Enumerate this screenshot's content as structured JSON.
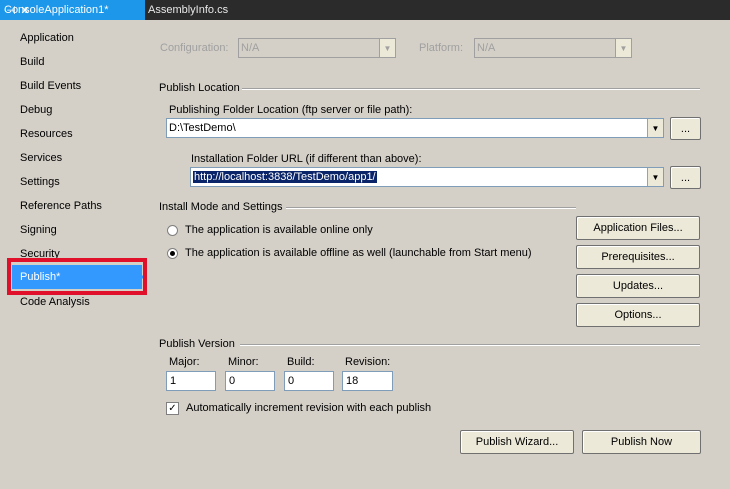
{
  "tabs": {
    "active_label": "ConsoleApplication1*",
    "pin_glyph": "⊣",
    "close_glyph": "✕",
    "inactive_label": "AssemblyInfo.cs"
  },
  "nav": {
    "items": [
      "Application",
      "Build",
      "Build Events",
      "Debug",
      "Resources",
      "Services",
      "Settings",
      "Reference Paths",
      "Signing",
      "Security"
    ],
    "selected": "Publish*",
    "after": "Code Analysis"
  },
  "config": {
    "configuration_label": "Configuration:",
    "configuration_value": "N/A",
    "platform_label": "Platform:",
    "platform_value": "N/A"
  },
  "publish_location": {
    "title": "Publish Location",
    "folder_label": "Publishing Folder Location (ftp server or file path):",
    "folder_value": "D:\\TestDemo\\",
    "browse": "...",
    "install_label": "Installation Folder URL (if different than above):",
    "install_value": "http://localhost:3838/TestDemo/app1/"
  },
  "install_mode": {
    "title": "Install Mode and Settings",
    "online_label": "The application is available online only",
    "offline_label": "The application is available offline as well (launchable from Start menu)",
    "selected": "offline"
  },
  "buttons": {
    "application_files": "Application Files...",
    "prerequisites": "Prerequisites...",
    "updates": "Updates...",
    "options": "Options...",
    "publish_wizard": "Publish Wizard...",
    "publish_now": "Publish Now"
  },
  "publish_version": {
    "title": "Publish Version",
    "major_label": "Major:",
    "major": "1",
    "minor_label": "Minor:",
    "minor": "0",
    "build_label": "Build:",
    "build": "0",
    "revision_label": "Revision:",
    "revision": "18",
    "auto_increment_label": "Automatically increment revision with each publish",
    "auto_increment": true,
    "check_glyph": "✓"
  },
  "icons": {
    "dropdown": "▼"
  },
  "colors": {
    "accent": "#3399ff",
    "tab_active": "#1c97ea",
    "highlight": "#e0102a"
  }
}
